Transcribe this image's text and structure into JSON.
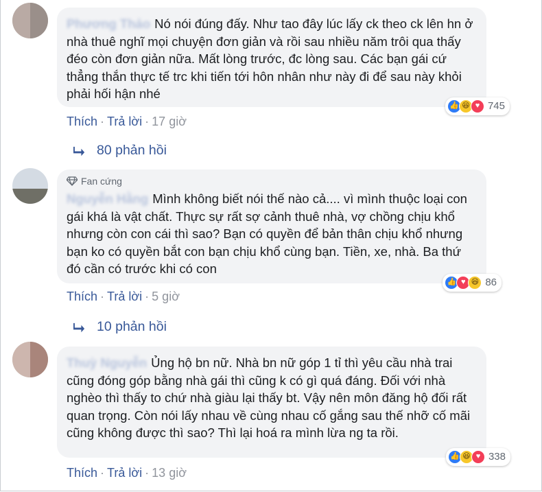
{
  "comments": [
    {
      "author": "Phương Thảo",
      "badge": "",
      "text": "Nó nói đúng đấy. Như tao đây lúc lấy ck theo ck lên hn ở nhà thuê nghĩ mọi chuyện đơn giản và rồi sau nhiều năm trôi qua thấy đéo còn đơn giản nữa. Mất lòng trước, đc lòng sau. Các bạn gái cứ thẳng thắn thực tế trc khi tiến tới hôn nhân như này đi để sau này khỏi phải hối hận nhé",
      "reaction_count": "745",
      "like_label": "Thích",
      "reply_label": "Trả lời",
      "time": "17 giờ",
      "replies_label": "80 phản hồi"
    },
    {
      "author": "Nguyễn Hằng",
      "badge": "Fan cứng",
      "text": "Mình không biết nói thế nào cả.... vì mình thuộc loại con gái khá là vật chất. Thực sự rất sợ cảnh thuê nhà, vợ chồng chịu khổ nhưng còn con cái thì sao? Bạn có quyền để bản thân chịu khổ nhưng bạn ko có quyền bắt con bạn chịu khổ cùng bạn. Tiền, xe, nhà. Ba thứ đó cần có trước khi có con",
      "reaction_count": "86",
      "like_label": "Thích",
      "reply_label": "Trả lời",
      "time": "5 giờ",
      "replies_label": "10 phản hồi"
    },
    {
      "author": "Thuỳ Nguyễn",
      "badge": "",
      "text": "Ủng hộ bn nữ. Nhà bn nữ góp 1 tỉ thì yêu cầu nhà trai cũng đóng góp bằng nhà gái thì cũng k có gì quá đáng. Đối với nhà nghèo thì thấy to chứ nhà giàu lại thấy bt. Vậy nên môn đăng hộ đối rất quan trọng. Còn nói lấy nhau về cùng nhau cố gắng sau thế nhỡ cố mãi cũng không được thì sao? Thì lại hoá ra mình lừa ng ta rồi.",
      "reaction_count": "338",
      "like_label": "Thích",
      "reply_label": "Trả lời",
      "time": "13 giờ",
      "replies_label": ""
    }
  ],
  "icons": {
    "like": "thumbs-up-icon",
    "haha": "laughing-face-icon",
    "love": "heart-icon",
    "reply_arrow": "reply-arrow-icon",
    "badge": "diamond-icon"
  },
  "colors": {
    "link": "#385898",
    "bubble": "#f2f3f5",
    "meta": "#90949c",
    "like": "#2e7bf6",
    "love": "#f33e58",
    "haha": "#f7c72a"
  }
}
